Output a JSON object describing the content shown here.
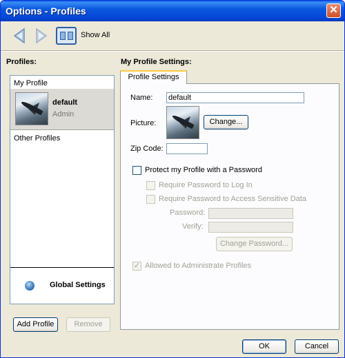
{
  "window": {
    "title": "Options - Profiles",
    "close_glyph": "✕"
  },
  "toolbar": {
    "back_icon": "back-arrow-icon",
    "forward_icon": "forward-arrow-icon",
    "show_all_label": "Show All"
  },
  "profiles": {
    "heading": "Profiles:",
    "my_profile_label": "My Profile",
    "selected": {
      "name": "default",
      "role": "Admin"
    },
    "other_profiles_label": "Other Profiles",
    "global_settings_label": "Global Settings",
    "add_button": "Add Profile",
    "remove_button": "Remove"
  },
  "settings": {
    "heading": "My Profile Settings:",
    "tab_label": "Profile Settings",
    "name_label": "Name:",
    "name_value": "default",
    "picture_label": "Picture:",
    "change_button": "Change...",
    "zip_label": "Zip Code:",
    "zip_value": "",
    "protect_label": "Protect my Profile with a Password",
    "require_login_label": "Require Password to Log In",
    "require_sensitive_label": "Require Password to Access Sensitive Data",
    "password_label": "Password:",
    "verify_label": "Verify:",
    "change_password_button": "Change Password...",
    "allowed_admin_label": "Allowed  to Administrate Profiles",
    "allowed_admin_checked": true
  },
  "footer": {
    "ok_label": "OK",
    "cancel_label": "Cancel"
  },
  "colors": {
    "title_bar": "#0b58df",
    "selected_row": "#dcdad5",
    "tab_accent": "#ffc83c",
    "dialog_bg": "#ece9d8"
  }
}
